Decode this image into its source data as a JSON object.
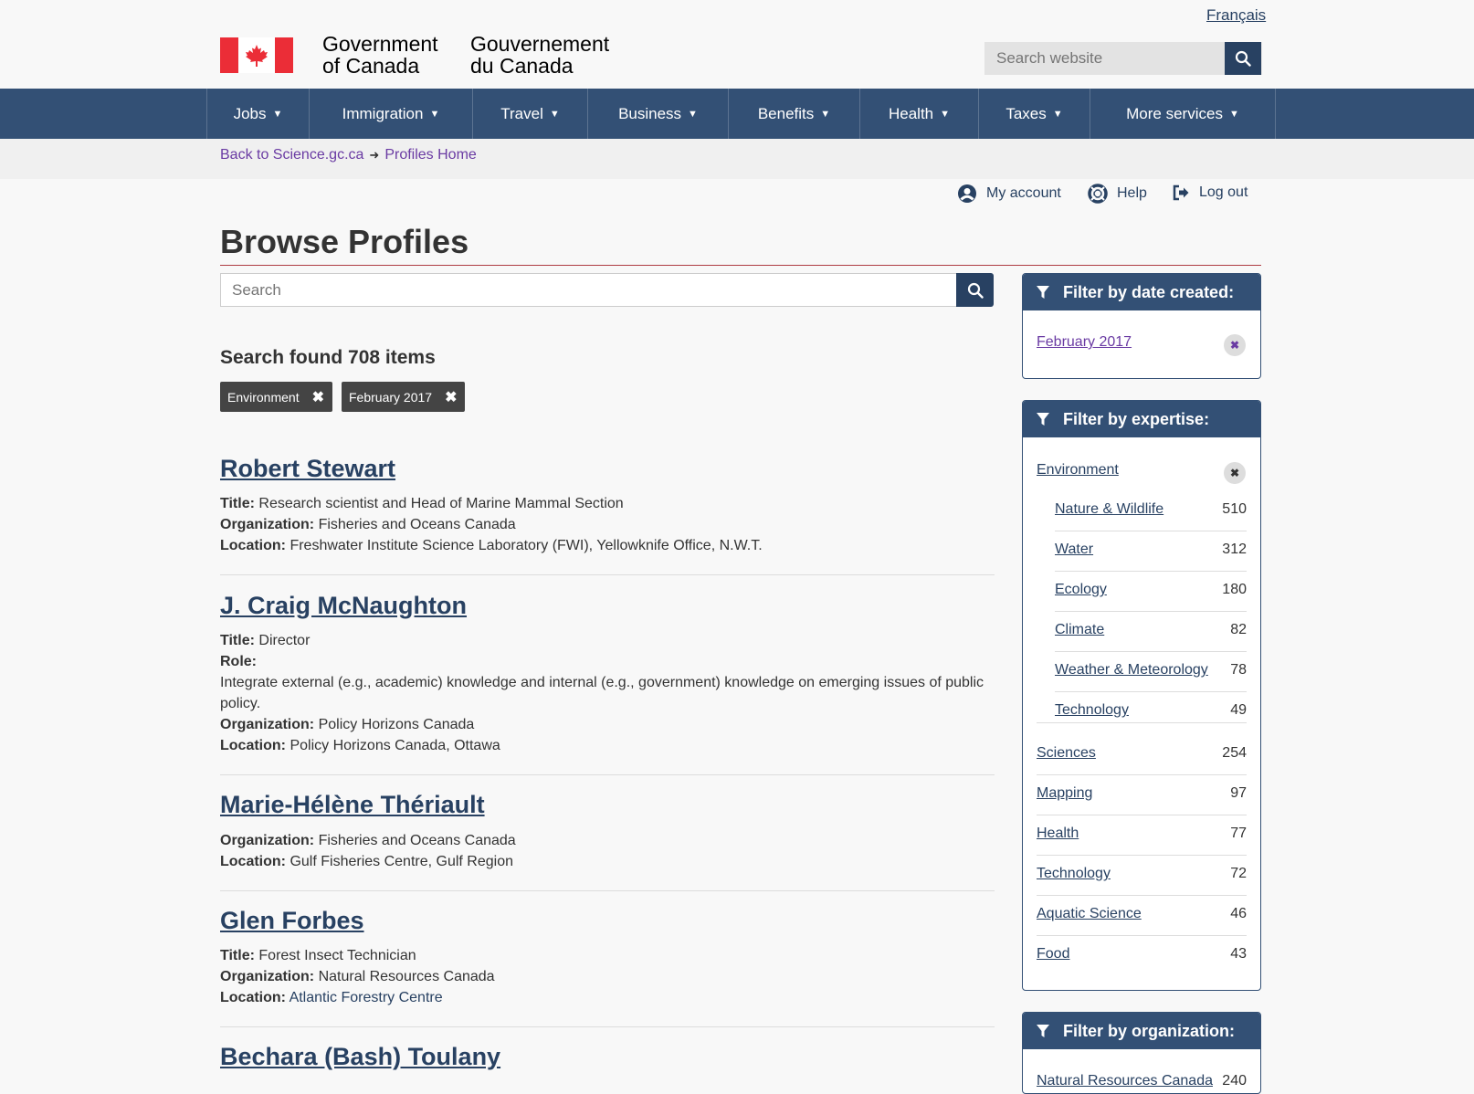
{
  "header": {
    "language_link": "Français",
    "signature_en_line1": "Government",
    "signature_en_line2": "of Canada",
    "signature_fr_line1": "Gouvernement",
    "signature_fr_line2": "du Canada",
    "site_search_placeholder": "Search website"
  },
  "nav": {
    "items": [
      {
        "label": "Jobs"
      },
      {
        "label": "Immigration"
      },
      {
        "label": "Travel"
      },
      {
        "label": "Business"
      },
      {
        "label": "Benefits"
      },
      {
        "label": "Health"
      },
      {
        "label": "Taxes"
      },
      {
        "label": "More services"
      }
    ]
  },
  "breadcrumb": {
    "back_label": "Back to Science.gc.ca",
    "home_label": "Profiles Home"
  },
  "account": {
    "my_account": "My account",
    "help": "Help",
    "logout": "Log out"
  },
  "page": {
    "title": "Browse Profiles",
    "search_placeholder": "Search",
    "results_heading": "Search found 708 items",
    "active_tags": [
      "Environment",
      "February 2017"
    ]
  },
  "profiles": [
    {
      "name": "Robert Stewart",
      "title_label": "Title:",
      "title": "Research scientist and Head of Marine Mammal Section",
      "org_label": "Organization:",
      "org": "Fisheries and Oceans Canada",
      "loc_label": "Location:",
      "loc": "Freshwater Institute Science Laboratory (FWI), Yellowknife Office, N.W.T."
    },
    {
      "name": "J. Craig McNaughton",
      "title_label": "Title:",
      "title": "Director",
      "role_label": "Role:",
      "role_line1": "Integrate external (e.g., academic) knowledge and internal (e.g., government) knowledge on emerging issues of public",
      "role_line2": "policy.",
      "org_label": "Organization:",
      "org": "Policy Horizons Canada",
      "loc_label": "Location:",
      "loc": "Policy Horizons Canada, Ottawa"
    },
    {
      "name": "Marie-Hélène Thériault",
      "org_label": "Organization:",
      "org": "Fisheries and Oceans Canada",
      "loc_label": "Location:",
      "loc": "Gulf Fisheries Centre, Gulf Region"
    },
    {
      "name": "Glen Forbes",
      "title_label": "Title:",
      "title": "Forest Insect Technician",
      "org_label": "Organization:",
      "org": "Natural Resources Canada",
      "loc_label": "Location:",
      "loc": "Atlantic Forestry Centre"
    },
    {
      "name": "Bechara (Bash) Toulany"
    }
  ],
  "sidebar": {
    "date_panel": {
      "heading": "Filter by date created:",
      "selected": "February 2017"
    },
    "expertise_panel": {
      "heading": "Filter by expertise:",
      "selected": "Environment",
      "sub_items": [
        {
          "label": "Nature & Wildlife",
          "count": "510"
        },
        {
          "label": "Water",
          "count": "312"
        },
        {
          "label": "Ecology",
          "count": "180"
        },
        {
          "label": "Climate",
          "count": "82"
        },
        {
          "label": "Weather & Meteorology",
          "count": "78"
        },
        {
          "label": "Technology",
          "count": "49"
        }
      ],
      "items": [
        {
          "label": "Sciences",
          "count": "254"
        },
        {
          "label": "Mapping",
          "count": "97"
        },
        {
          "label": "Health",
          "count": "77"
        },
        {
          "label": "Technology",
          "count": "72"
        },
        {
          "label": "Aquatic Science",
          "count": "46"
        },
        {
          "label": "Food",
          "count": "43"
        }
      ]
    },
    "org_panel": {
      "heading": "Filter by organization:",
      "first_item": "Natural Resources Canada",
      "first_count": "240"
    }
  },
  "colors": {
    "nav_bg": "#335075",
    "link": "#284162",
    "visited_link": "#6a3ba3",
    "flag_red": "#eb2d37",
    "title_rule": "#af3c43"
  }
}
